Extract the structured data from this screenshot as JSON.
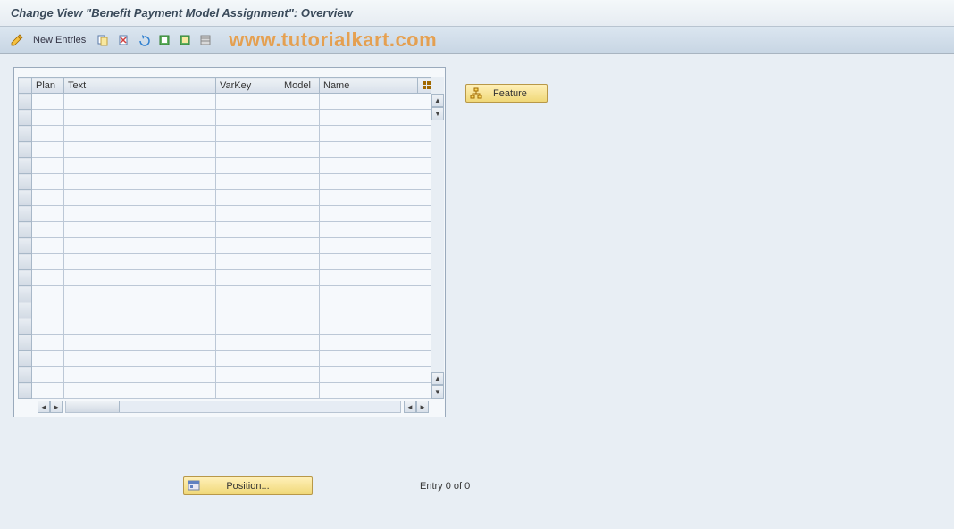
{
  "title": "Change View \"Benefit Payment Model Assignment\": Overview",
  "toolbar": {
    "new_entries_label": "New Entries"
  },
  "watermark": "www.tutorialkart.com",
  "table": {
    "columns": {
      "plan": "Plan",
      "text": "Text",
      "varkey": "VarKey",
      "model": "Model",
      "name": "Name"
    },
    "rows": [
      {
        "plan": "",
        "text": "",
        "varkey": "",
        "model": "",
        "name": ""
      },
      {
        "plan": "",
        "text": "",
        "varkey": "",
        "model": "",
        "name": ""
      },
      {
        "plan": "",
        "text": "",
        "varkey": "",
        "model": "",
        "name": ""
      },
      {
        "plan": "",
        "text": "",
        "varkey": "",
        "model": "",
        "name": ""
      },
      {
        "plan": "",
        "text": "",
        "varkey": "",
        "model": "",
        "name": ""
      },
      {
        "plan": "",
        "text": "",
        "varkey": "",
        "model": "",
        "name": ""
      },
      {
        "plan": "",
        "text": "",
        "varkey": "",
        "model": "",
        "name": ""
      },
      {
        "plan": "",
        "text": "",
        "varkey": "",
        "model": "",
        "name": ""
      },
      {
        "plan": "",
        "text": "",
        "varkey": "",
        "model": "",
        "name": ""
      },
      {
        "plan": "",
        "text": "",
        "varkey": "",
        "model": "",
        "name": ""
      },
      {
        "plan": "",
        "text": "",
        "varkey": "",
        "model": "",
        "name": ""
      },
      {
        "plan": "",
        "text": "",
        "varkey": "",
        "model": "",
        "name": ""
      },
      {
        "plan": "",
        "text": "",
        "varkey": "",
        "model": "",
        "name": ""
      },
      {
        "plan": "",
        "text": "",
        "varkey": "",
        "model": "",
        "name": ""
      },
      {
        "plan": "",
        "text": "",
        "varkey": "",
        "model": "",
        "name": ""
      },
      {
        "plan": "",
        "text": "",
        "varkey": "",
        "model": "",
        "name": ""
      },
      {
        "plan": "",
        "text": "",
        "varkey": "",
        "model": "",
        "name": ""
      },
      {
        "plan": "",
        "text": "",
        "varkey": "",
        "model": "",
        "name": ""
      },
      {
        "plan": "",
        "text": "",
        "varkey": "",
        "model": "",
        "name": ""
      }
    ]
  },
  "feature": {
    "label": "Feature"
  },
  "footer": {
    "position_label": "Position...",
    "entry_text": "Entry 0 of 0"
  }
}
